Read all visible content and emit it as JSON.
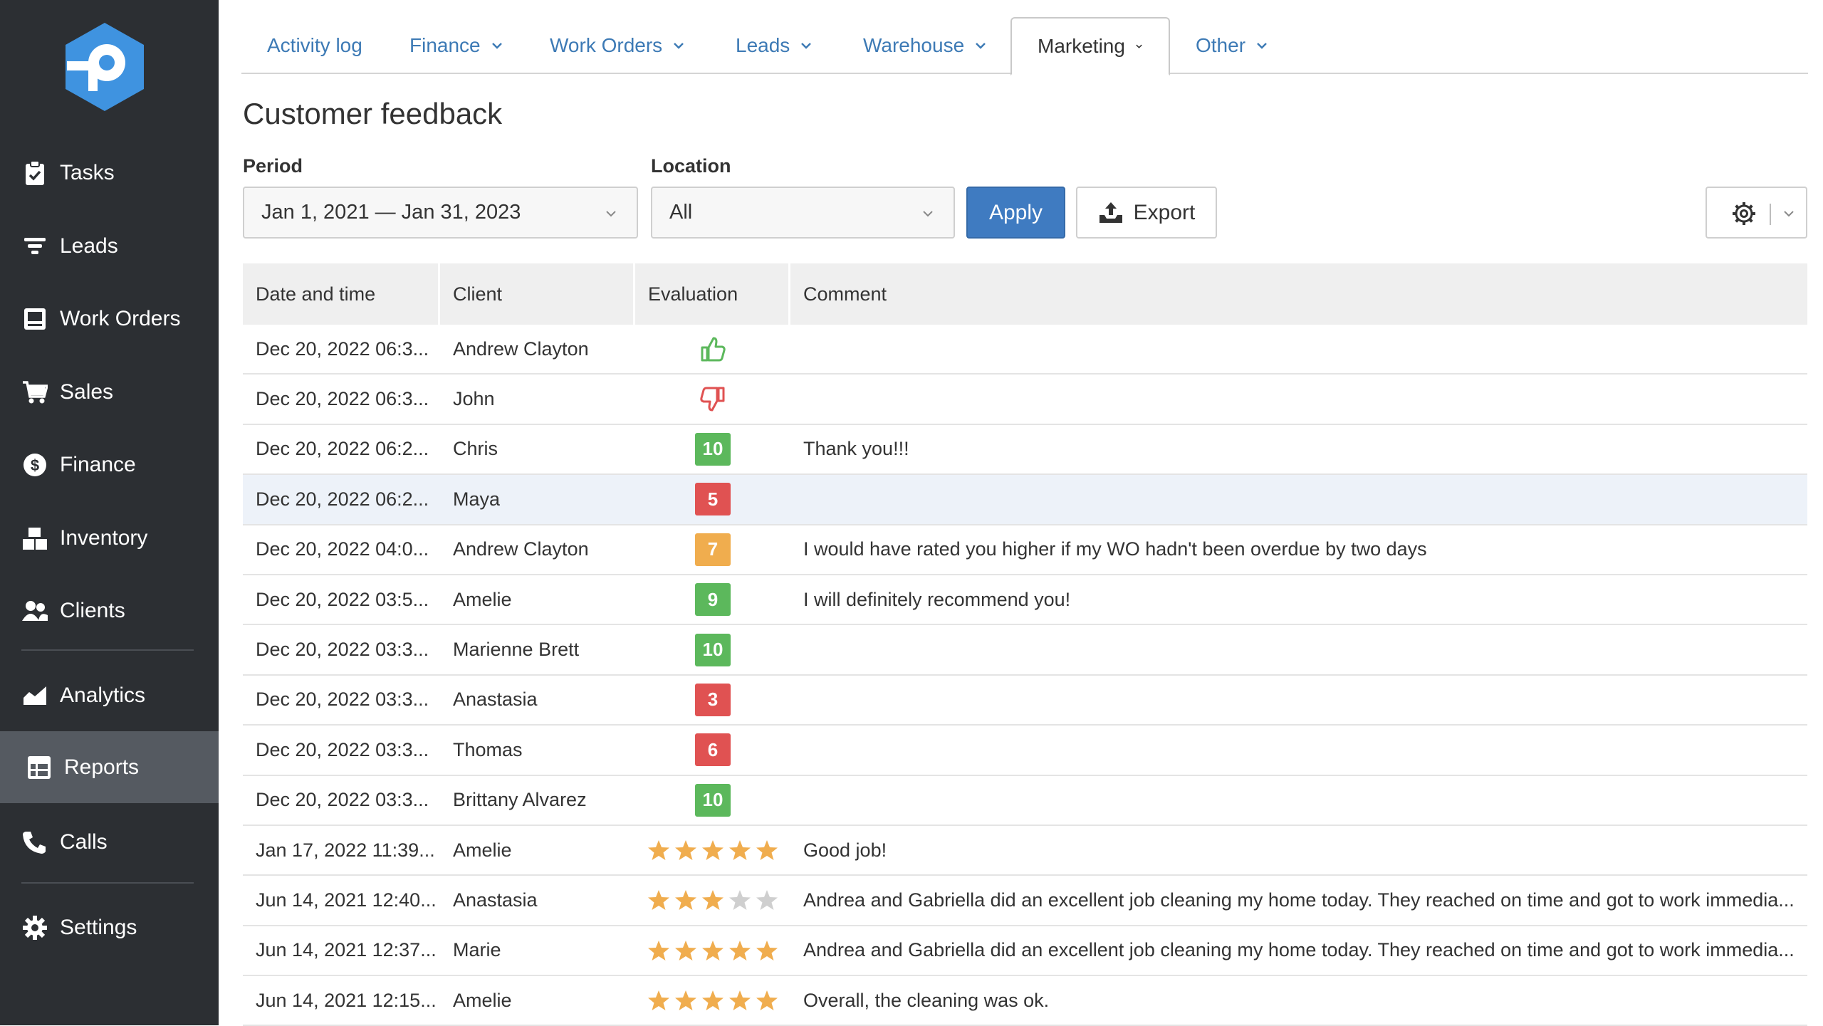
{
  "colors": {
    "sidebar_bg": "#2c2f33",
    "sidebar_active": "#555a61",
    "link_blue": "#3d7ab5",
    "apply_blue": "#3f7bc1",
    "badge_green": "#5cb85c",
    "badge_red": "#e05252",
    "badge_orange": "#f0ad4e",
    "star_gold": "#f0ad4e",
    "star_gray": "#cfcfcf",
    "thumb_up": "#5cb85c",
    "thumb_down": "#e05252"
  },
  "sidebar": {
    "logo_icon": "p-hexagon-logo",
    "items": [
      {
        "label": "Tasks",
        "icon": "clipboard-icon"
      },
      {
        "label": "Leads",
        "icon": "filter-icon"
      },
      {
        "label": "Work Orders",
        "icon": "work-order-icon"
      },
      {
        "label": "Sales",
        "icon": "cart-icon"
      },
      {
        "label": "Finance",
        "icon": "dollar-icon"
      },
      {
        "label": "Inventory",
        "icon": "boxes-icon"
      },
      {
        "label": "Clients",
        "icon": "users-icon"
      },
      {
        "label": "Analytics",
        "icon": "chart-area-icon"
      },
      {
        "label": "Reports",
        "icon": "reports-icon",
        "active": true
      },
      {
        "label": "Calls",
        "icon": "phone-icon"
      },
      {
        "label": "Settings",
        "icon": "gear-icon"
      }
    ]
  },
  "tabs": [
    {
      "label": "Activity log",
      "dropdown": false
    },
    {
      "label": "Finance",
      "dropdown": true
    },
    {
      "label": "Work Orders",
      "dropdown": true
    },
    {
      "label": "Leads",
      "dropdown": true
    },
    {
      "label": "Warehouse",
      "dropdown": true
    },
    {
      "label": "Marketing",
      "dropdown": true,
      "active": true
    },
    {
      "label": "Other",
      "dropdown": true
    }
  ],
  "page": {
    "title": "Customer feedback",
    "period_label": "Period",
    "period_value": "Jan 1, 2021 — Jan 31, 2023",
    "location_label": "Location",
    "location_value": "All",
    "apply_label": "Apply",
    "export_label": "Export"
  },
  "table": {
    "headers": [
      "Date and time",
      "Client",
      "Evaluation",
      "Comment"
    ],
    "rows": [
      {
        "date": "Dec 20, 2022 06:3...",
        "client": "Andrew Clayton",
        "eval_type": "thumb-up",
        "comment": ""
      },
      {
        "date": "Dec 20, 2022 06:3...",
        "client": "John",
        "eval_type": "thumb-down",
        "comment": ""
      },
      {
        "date": "Dec 20, 2022 06:2...",
        "client": "Chris",
        "eval_type": "score",
        "score": "10",
        "comment": "Thank you!!!"
      },
      {
        "date": "Dec 20, 2022 06:2...",
        "client": "Maya",
        "eval_type": "score",
        "score": "5",
        "comment": "",
        "highlight": true
      },
      {
        "date": "Dec 20, 2022 04:0...",
        "client": "Andrew Clayton",
        "eval_type": "score",
        "score": "7",
        "comment": "I would have rated you higher if my WO hadn't been overdue by two days"
      },
      {
        "date": "Dec 20, 2022 03:5...",
        "client": "Amelie",
        "eval_type": "score",
        "score": "9",
        "comment": "I will definitely recommend you!"
      },
      {
        "date": "Dec 20, 2022 03:3...",
        "client": "Marienne Brett",
        "eval_type": "score",
        "score": "10",
        "comment": ""
      },
      {
        "date": "Dec 20, 2022 03:3...",
        "client": "Anastasia",
        "eval_type": "score",
        "score": "3",
        "comment": ""
      },
      {
        "date": "Dec 20, 2022 03:3...",
        "client": "Thomas",
        "eval_type": "score",
        "score": "6",
        "comment": ""
      },
      {
        "date": "Dec 20, 2022 03:3...",
        "client": "Brittany Alvarez",
        "eval_type": "score",
        "score": "10",
        "comment": ""
      },
      {
        "date": "Jan 17, 2022 11:39...",
        "client": "Amelie",
        "eval_type": "stars",
        "stars": 5,
        "comment": "Good job!"
      },
      {
        "date": "Jun 14, 2021 12:40...",
        "client": "Anastasia",
        "eval_type": "stars",
        "stars": 3,
        "comment": "Andrea and Gabriella did an excellent job cleaning my home today. They reached on time and got to work immedia..."
      },
      {
        "date": "Jun 14, 2021 12:37...",
        "client": "Marie",
        "eval_type": "stars",
        "stars": 5,
        "comment": "Andrea and Gabriella did an excellent job cleaning my home today. They reached on time and got to work immedia..."
      },
      {
        "date": "Jun 14, 2021 12:15...",
        "client": "Amelie",
        "eval_type": "stars",
        "stars": 5,
        "comment": "Overall, the cleaning was ok."
      }
    ]
  }
}
